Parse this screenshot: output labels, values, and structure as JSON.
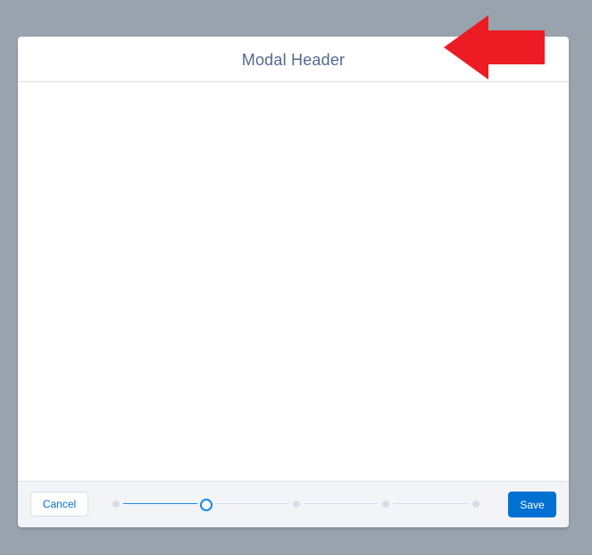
{
  "modal": {
    "title": "Modal Header"
  },
  "footer": {
    "cancel_label": "Cancel",
    "save_label": "Save"
  },
  "progress": {
    "steps": 5,
    "current_step": 2,
    "fill_fraction": 0.25
  },
  "colors": {
    "backdrop": "#98a3ae",
    "brand": "#0070d2",
    "progress_active": "#1589ee",
    "annotation_arrow": "#ed1c24"
  },
  "annotation": {
    "icon": "red-arrow-left-icon"
  }
}
